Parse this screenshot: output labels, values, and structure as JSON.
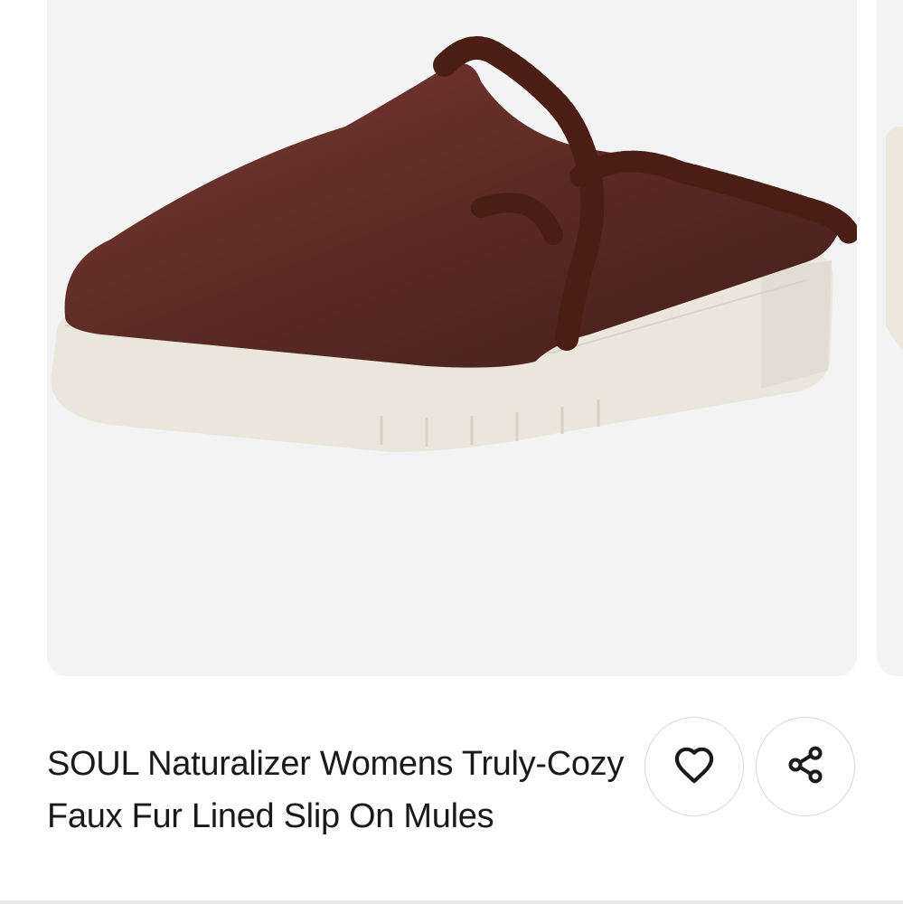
{
  "product": {
    "title": "SOUL Naturalizer Womens Truly-Cozy Faux Fur Lined Slip On Mules",
    "image_alt": "Brown faux suede slip-on mule with faux fur lining and white platform sole"
  },
  "actions": {
    "favorite_icon": "heart-icon",
    "share_icon": "share-icon"
  },
  "colors": {
    "card_bg": "#f3f3f3",
    "shoe_upper": "#5a2a24",
    "fur": "#4e1f17",
    "sole": "#ece8df"
  }
}
